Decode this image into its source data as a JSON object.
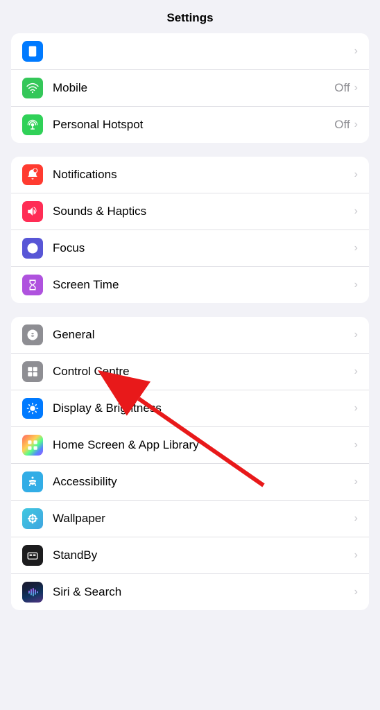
{
  "page": {
    "title": "Settings"
  },
  "group1": {
    "rows": [
      {
        "id": "mobile",
        "label": "Mobile",
        "value": "Off",
        "icon_color": "bg-green",
        "icon_type": "mobile"
      },
      {
        "id": "personal-hotspot",
        "label": "Personal Hotspot",
        "value": "Off",
        "icon_color": "bg-green2",
        "icon_type": "hotspot"
      }
    ]
  },
  "group2": {
    "rows": [
      {
        "id": "notifications",
        "label": "Notifications",
        "value": "",
        "icon_color": "bg-red",
        "icon_type": "notifications"
      },
      {
        "id": "sounds-haptics",
        "label": "Sounds & Haptics",
        "value": "",
        "icon_color": "bg-pink",
        "icon_type": "sounds"
      },
      {
        "id": "focus",
        "label": "Focus",
        "value": "",
        "icon_color": "bg-purple",
        "icon_type": "focus"
      },
      {
        "id": "screen-time",
        "label": "Screen Time",
        "value": "",
        "icon_color": "bg-purple2",
        "icon_type": "screentime"
      }
    ]
  },
  "group3": {
    "rows": [
      {
        "id": "general",
        "label": "General",
        "value": "",
        "icon_color": "bg-gray",
        "icon_type": "general"
      },
      {
        "id": "control-centre",
        "label": "Control Centre",
        "value": "",
        "icon_color": "bg-gray",
        "icon_type": "controlcentre"
      },
      {
        "id": "display-brightness",
        "label": "Display & Brightness",
        "value": "",
        "icon_color": "bg-blue",
        "icon_type": "display"
      },
      {
        "id": "home-screen",
        "label": "Home Screen & App Library",
        "value": "",
        "icon_color": "bg-purple2",
        "icon_type": "homescreen"
      },
      {
        "id": "accessibility",
        "label": "Accessibility",
        "value": "",
        "icon_color": "bg-blue2",
        "icon_type": "accessibility"
      },
      {
        "id": "wallpaper",
        "label": "Wallpaper",
        "value": "",
        "icon_color": "bg-teal",
        "icon_type": "wallpaper"
      },
      {
        "id": "standby",
        "label": "StandBy",
        "value": "",
        "icon_color": "bg-black",
        "icon_type": "standby"
      },
      {
        "id": "siri-search",
        "label": "Siri & Search",
        "value": "",
        "icon_color": "bg-gradient-siri",
        "icon_type": "siri"
      }
    ]
  },
  "chevron": "›"
}
